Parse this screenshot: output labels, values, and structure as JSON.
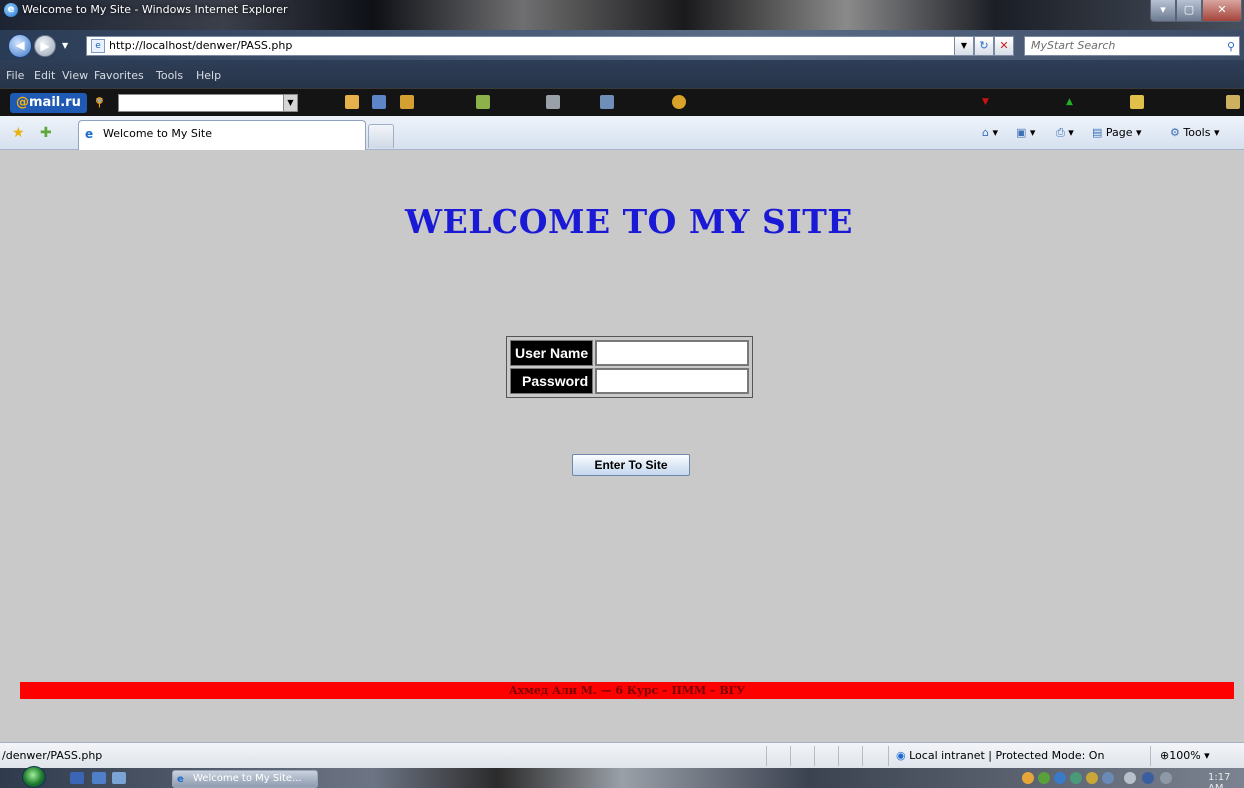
{
  "window": {
    "title": "Welcome to My Site - Windows Internet Explorer",
    "min": "▾",
    "max": "▢",
    "close": "✕"
  },
  "address": {
    "url": "http://localhost/denwer/PASS.php",
    "search_placeholder": "MyStart Search"
  },
  "menu": [
    "File",
    "Edit",
    "View",
    "Favorites",
    "Tools",
    "Help"
  ],
  "mailru": {
    "logo_at": "@",
    "logo_text": "mail.ru"
  },
  "tabs": {
    "active_label": "Welcome to My Site",
    "page_label": "Page",
    "tools_label": "Tools"
  },
  "page": {
    "heading": "WELCOME TO MY SITE",
    "username_label": "User Name",
    "password_label": "Password",
    "submit_label": "Enter To Site",
    "footer_text": "Ахмед Али М. — 6 Курс – ПММ – ВГУ"
  },
  "status": {
    "url": "/denwer/PASS.php",
    "zone": "Local intranet | Protected Mode: On",
    "zoom": "100%"
  },
  "taskbar": {
    "item_label": "Welcome to My Site...",
    "clock": "1:17 AM"
  },
  "colors": {
    "page_bg": "#c9c9c9",
    "heading": "#1a1ad6",
    "footer_bar": "#ff0000"
  }
}
